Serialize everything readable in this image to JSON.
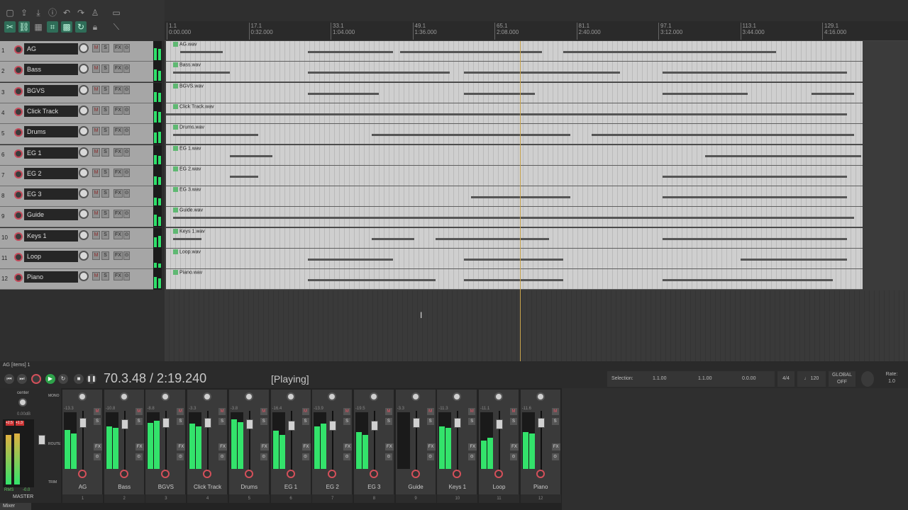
{
  "status_line": "AG [items] 1",
  "ruler": [
    {
      "bar": "1.1",
      "time": "0:00.000"
    },
    {
      "bar": "17.1",
      "time": "0:32.000"
    },
    {
      "bar": "33.1",
      "time": "1:04.000"
    },
    {
      "bar": "49.1",
      "time": "1:36.000"
    },
    {
      "bar": "65.1",
      "time": "2:08.000"
    },
    {
      "bar": "81.1",
      "time": "2:40.000"
    },
    {
      "bar": "97.1",
      "time": "3:12.000"
    },
    {
      "bar": "113.1",
      "time": "3:44.000"
    },
    {
      "bar": "129.1",
      "time": "4:16.000"
    }
  ],
  "tracks": [
    {
      "num": "1",
      "name": "AG",
      "file": "AG.wav",
      "mixer_vol": "-13.3"
    },
    {
      "num": "2",
      "name": "Bass",
      "file": "Bass.wav",
      "mixer_vol": "-10.8"
    },
    {
      "num": "3",
      "name": "BGVS",
      "file": "BGVS.wav",
      "mixer_vol": "-8.8"
    },
    {
      "num": "4",
      "name": "Click Track",
      "file": "Click Track.wav",
      "mixer_vol": "-3.3"
    },
    {
      "num": "5",
      "name": "Drums",
      "file": "Drums.wav",
      "mixer_vol": "-3.8"
    },
    {
      "num": "6",
      "name": "EG 1",
      "file": "EG 1.wav",
      "mixer_vol": "-16.4"
    },
    {
      "num": "7",
      "name": "EG 2",
      "file": "EG 2.wav",
      "mixer_vol": "-13.9"
    },
    {
      "num": "8",
      "name": "EG 3",
      "file": "EG 3.wav",
      "mixer_vol": "-19.5"
    },
    {
      "num": "9",
      "name": "Guide",
      "file": "Guide.wav",
      "mixer_vol": "-3.3"
    },
    {
      "num": "10",
      "name": "Keys 1",
      "file": "Keys 1.wav",
      "mixer_vol": "-11.3"
    },
    {
      "num": "11",
      "name": "Loop",
      "file": "Loop.wav",
      "mixer_vol": "-11.1"
    },
    {
      "num": "12",
      "name": "Piano",
      "file": "Piano.wav",
      "mixer_vol": "-11.6"
    }
  ],
  "track_button_labels": {
    "mute": "M",
    "solo": "S",
    "fx": "FX",
    "io": "⊙"
  },
  "transport": {
    "time": "70.3.48 / 2:19.240",
    "state": "[Playing]",
    "selection_label": "Selection:",
    "selection_start": "1.1.00",
    "selection_end": "1.1.00",
    "selection_len": "0.0.00",
    "time_sig": "4/4",
    "bpm": "120",
    "global_label": "GLOBAL",
    "global_state": "OFF",
    "rate_label": "Rate:",
    "rate_value": "1.0"
  },
  "master": {
    "label": "MASTER",
    "pan": "center",
    "vol": "0.00dB",
    "peak_l": "+2.5",
    "peak_r": "+1.3",
    "rms_label": "RMS",
    "rms_value": "-0.0",
    "mono": "MONO",
    "route": "ROUTE",
    "trim": "TRIM"
  },
  "mixer_tab": "Mixer",
  "colors": {
    "meter": "#2ee06a",
    "record": "#d3505a",
    "play": "#2ea24a",
    "playhead": "#c8a24a"
  }
}
